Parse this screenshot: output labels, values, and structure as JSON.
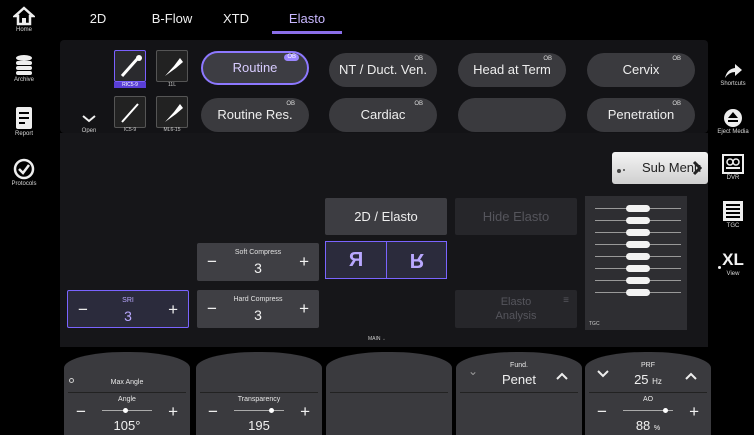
{
  "left_sidebar": {
    "items": [
      {
        "label": "Home",
        "icon": "home-icon"
      },
      {
        "label": "Archive",
        "icon": "archive-icon"
      },
      {
        "label": "Report",
        "icon": "report-icon"
      },
      {
        "label": "Protocols",
        "icon": "protocols-icon"
      }
    ]
  },
  "right_sidebar": {
    "items": [
      {
        "label": "Shortcuts",
        "icon": "shortcuts-icon"
      },
      {
        "label": "Eject Media",
        "icon": "eject-icon"
      },
      {
        "label": "DVR",
        "icon": "dvr-icon"
      },
      {
        "label": "TGC",
        "icon": "tgc-icon"
      },
      {
        "label": "View",
        "icon": "view-icon",
        "glyph": "XL"
      }
    ]
  },
  "tabs": [
    {
      "label": "2D"
    },
    {
      "label": "B-Flow"
    },
    {
      "label": "XTD"
    },
    {
      "label": "Elasto",
      "active": true
    }
  ],
  "probes": [
    {
      "label": "RIC5-9",
      "selected": true
    },
    {
      "label": "11L"
    },
    {
      "label": "IC5-9"
    },
    {
      "label": "ML6-15"
    }
  ],
  "open_toggle": {
    "label": "Open"
  },
  "presets": {
    "badge": "OB",
    "items": [
      {
        "label": "Routine",
        "active": true
      },
      {
        "label": "NT / Duct. Ven."
      },
      {
        "label": "Head at Term"
      },
      {
        "label": "Cervix"
      },
      {
        "label": "Routine Res."
      },
      {
        "label": "Cardiac"
      },
      {
        "label": ""
      },
      {
        "label": "Penetration"
      }
    ]
  },
  "sub_menu": {
    "label": "Sub Menu"
  },
  "controls": {
    "elasto_2d": "2D / Elasto",
    "hide_elasto": "Hide Elasto",
    "elasto_analysis": "Elasto Analysis",
    "soft_compress": {
      "label": "Soft Compress",
      "value": "3"
    },
    "hard_compress": {
      "label": "Hard Compress",
      "value": "3"
    },
    "sri": {
      "label": "SRI",
      "value": "3"
    },
    "direction_left": "Я",
    "direction_right": "R",
    "tgc_label": "TGC",
    "main_label": "MAIN"
  },
  "tgc_sliders": [
    0.5,
    0.5,
    0.5,
    0.5,
    0.5,
    0.5,
    0.5,
    0.5
  ],
  "knobs": [
    {
      "title": "Max Angle",
      "sub": "Angle",
      "value": "105°"
    },
    {
      "title": "",
      "sub": "Transparency",
      "value": "195"
    },
    {
      "title": "",
      "sub": "",
      "value": ""
    },
    {
      "title": "Fund.",
      "sub": "",
      "value": "Penet"
    },
    {
      "title": "PRF",
      "title_value": "25",
      "title_unit": "Hz",
      "sub": "AO",
      "value": "88",
      "value_unit": "%"
    }
  ],
  "colors": {
    "accent": "#8a6ee8",
    "panel": "#161619",
    "button": "#3d3d42"
  }
}
